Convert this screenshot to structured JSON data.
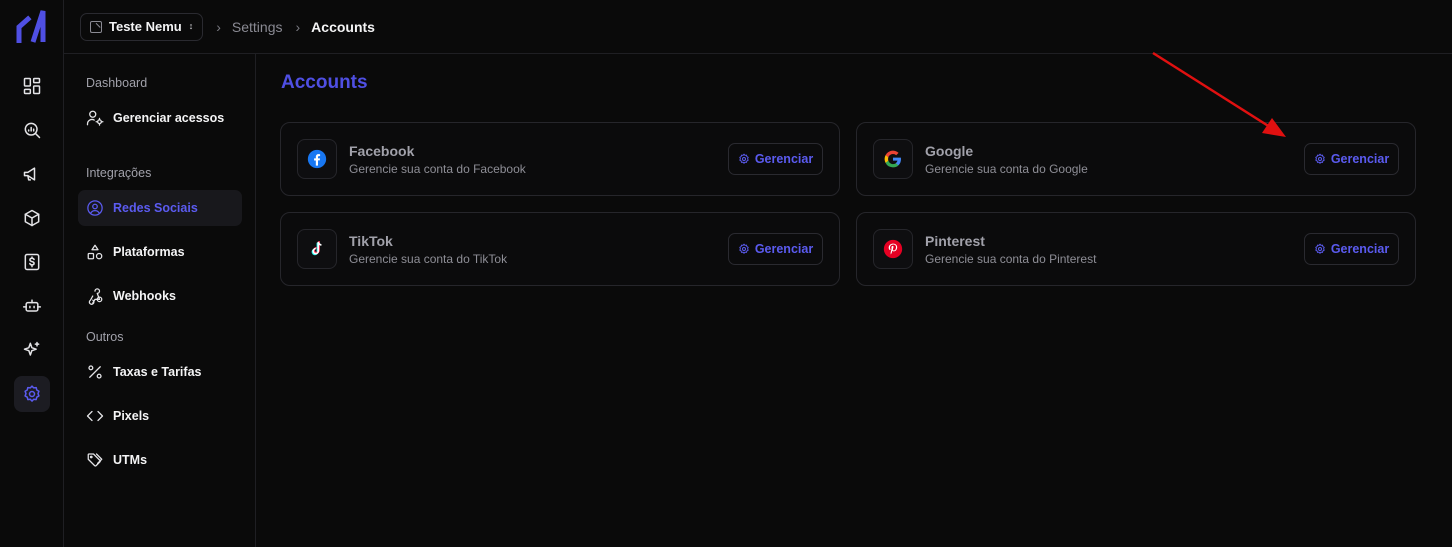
{
  "header": {
    "workspace": "Teste Nemu",
    "breadcrumb": [
      "Settings",
      "Accounts"
    ]
  },
  "rail": {
    "icons": [
      "dashboard-icon",
      "search-analytics-icon",
      "megaphone-icon",
      "box-icon",
      "dollar-icon",
      "bot-icon",
      "sparkles-icon",
      "settings-icon"
    ],
    "active": "settings-icon"
  },
  "sidebar": {
    "sections": [
      {
        "heading": "Dashboard",
        "items": [
          {
            "label": "Gerenciar acessos",
            "icon": "user-cog-icon"
          }
        ]
      },
      {
        "heading": "Integrações",
        "items": [
          {
            "label": "Redes Sociais",
            "icon": "user-circle-icon",
            "active": true
          },
          {
            "label": "Plataformas",
            "icon": "shapes-icon"
          },
          {
            "label": "Webhooks",
            "icon": "webhook-icon"
          }
        ]
      },
      {
        "heading": "Outros",
        "items": [
          {
            "label": "Taxas e Tarifas",
            "icon": "percent-icon"
          },
          {
            "label": "Pixels",
            "icon": "code-icon"
          },
          {
            "label": "UTMs",
            "icon": "tags-icon"
          }
        ]
      }
    ]
  },
  "main": {
    "title": "Accounts",
    "accounts": [
      {
        "name": "Facebook",
        "description": "Gerencie sua conta do Facebook",
        "button": "Gerenciar",
        "icon": "facebook-icon"
      },
      {
        "name": "Google",
        "description": "Gerencie sua conta do Google",
        "button": "Gerenciar",
        "icon": "google-icon"
      },
      {
        "name": "TikTok",
        "description": "Gerencie sua conta do TikTok",
        "button": "Gerenciar",
        "icon": "tiktok-icon"
      },
      {
        "name": "Pinterest",
        "description": "Gerencie sua conta do Pinterest",
        "button": "Gerenciar",
        "icon": "pinterest-icon"
      }
    ]
  },
  "colors": {
    "accent": "#5b5bf0",
    "annotation_arrow": "#e01010"
  }
}
